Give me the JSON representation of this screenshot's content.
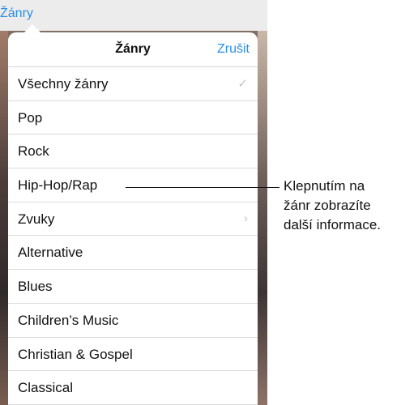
{
  "nav": {
    "back_label": "Žánry"
  },
  "popover": {
    "title": "Žánry",
    "cancel_label": "Zrušit",
    "items": [
      {
        "label": "Všechny žánry",
        "accessory": "✓",
        "accessory_name": "checkmark-icon"
      },
      {
        "label": "Pop"
      },
      {
        "label": "Rock"
      },
      {
        "label": "Hip-Hop/Rap"
      },
      {
        "label": "Zvuky",
        "accessory": "›",
        "accessory_name": "chevron-right-icon"
      },
      {
        "label": "Alternative"
      },
      {
        "label": "Blues"
      },
      {
        "label": "Children’s Music"
      },
      {
        "label": "Christian & Gospel"
      },
      {
        "label": "Classical"
      }
    ]
  },
  "callout": {
    "lines": [
      "Klepnutím na",
      "žánr zobrazíte",
      "další informace."
    ]
  },
  "colors": {
    "accent": "#2a8fe6",
    "separator": "#dcdcdc"
  }
}
